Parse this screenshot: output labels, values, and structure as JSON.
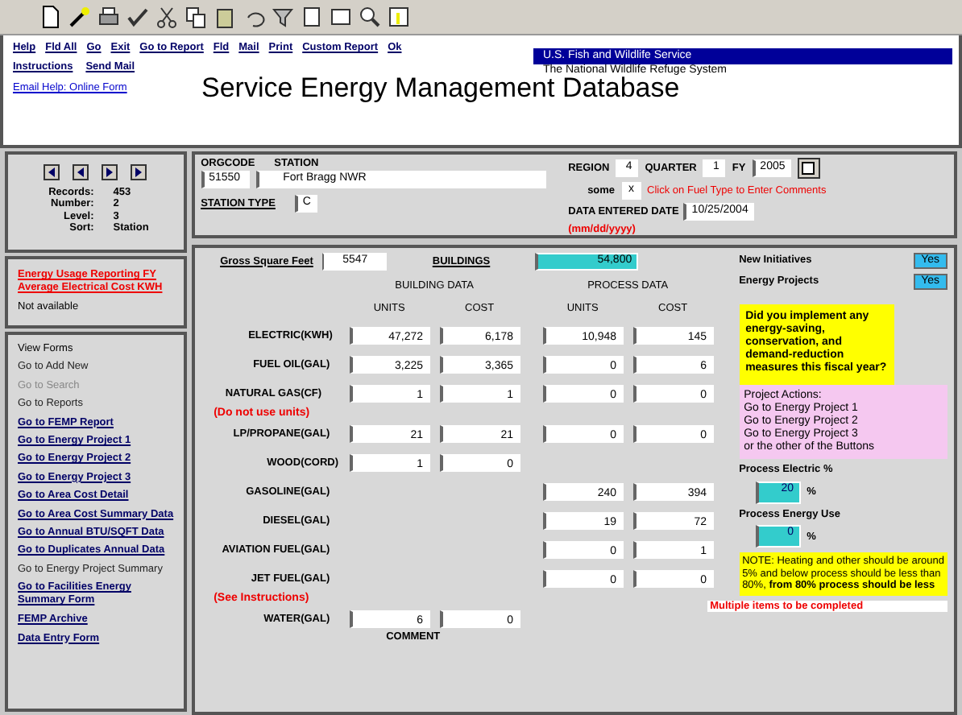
{
  "header": {
    "links_row1": [
      {
        "label": "Help"
      },
      {
        "label": "Fld All"
      },
      {
        "label": "Go"
      },
      {
        "label": "Exit"
      },
      {
        "label": "Go to Report"
      },
      {
        "label": "Fld"
      },
      {
        "label": "Mail"
      },
      {
        "label": "Print"
      },
      {
        "label": "Custom Report"
      },
      {
        "label": "Ok"
      }
    ],
    "links_row2": [
      {
        "label": "Instructions"
      },
      {
        "label": "Send Mail"
      }
    ],
    "help_link": "Email Help: Online Form",
    "title": "Service Energy Management Database",
    "agency": "U.S. Fish and Wildlife Service",
    "system": "The National Wildlife Refuge System"
  },
  "navigator": {
    "stats": [
      {
        "label": "Records:",
        "value": "453"
      },
      {
        "label": "Number:",
        "value": "2"
      },
      {
        "label": "Level:",
        "value": "3"
      },
      {
        "label": "Sort:",
        "value": "Station"
      }
    ]
  },
  "report_links": [
    {
      "label": "Energy Usage Reporting FY"
    },
    {
      "label": "Average Electrical Cost KWH"
    }
  ],
  "report_note": "Not available",
  "view_forms": {
    "heading": "View Forms",
    "items": [
      {
        "label": "Go to Add New",
        "kind": "text"
      },
      {
        "label": "Go to Search",
        "kind": "muted"
      },
      {
        "label": "Go to Reports",
        "kind": "text"
      },
      {
        "label": "Go to FEMP Report",
        "kind": "link"
      },
      {
        "label": "Go to Energy Project 1",
        "kind": "link"
      },
      {
        "label": "Go to Energy Project 2",
        "kind": "link"
      },
      {
        "label": "Go to Energy Project 3",
        "kind": "link"
      },
      {
        "label": "Go to Area Cost Detail",
        "kind": "link"
      },
      {
        "label": "Go to Area Cost Summary Data",
        "kind": "link"
      },
      {
        "label": "Go to Annual BTU/SQFT Data",
        "kind": "link"
      },
      {
        "label": "Go to Duplicates Annual Data",
        "kind": "link"
      },
      {
        "label": "Go to Energy Project Summary",
        "kind": "text"
      },
      {
        "label": "Go to Facilities Energy Summary Form",
        "kind": "link"
      },
      {
        "label": "FEMP Archive",
        "kind": "link"
      },
      {
        "label": "Data Entry Form",
        "kind": "link"
      }
    ]
  },
  "station": {
    "orgcode_label": "ORGCODE",
    "orgcode": "51550",
    "station_label": "STATION",
    "station": "Fort Bragg NWR",
    "type_label": "STATION TYPE",
    "type": "C",
    "region_label": "REGION",
    "region": "4",
    "quarter_label": "QUARTER",
    "quarter": "1",
    "fy_label": "FY",
    "fy": "2005",
    "some_label": "some",
    "some": "x",
    "comments_note": "Click on Fuel Type to Enter Comments",
    "date_label": "DATA ENTERED DATE",
    "date": "10/25/2004",
    "date_hint": "(mm/dd/yyyy)"
  },
  "form": {
    "gsf_label": "Gross Square Feet",
    "gsf": "5547",
    "buildings_label": "BUILDINGS",
    "buildings": "54,800",
    "initiatives": [
      {
        "label": "New Initiatives",
        "value": "Yes"
      },
      {
        "label": "Energy Projects",
        "value": "Yes"
      }
    ],
    "building_heading": "BUILDING DATA",
    "process_heading": "PROCESS DATA",
    "building_units_label": "UNITS",
    "building_cost_label": "COST",
    "process_units_label": "UNITS",
    "process_cost_label": "COST",
    "rows": [
      {
        "kind": "fuel",
        "name": "ELECTRIC",
        "unit": "(KWH)",
        "bu": "47,272",
        "bc": "6,178",
        "pu": "10,948",
        "pc": "145"
      },
      {
        "kind": "fuel",
        "name": "FUEL OIL",
        "unit": "(GAL)",
        "bu": "3,225",
        "bc": "3,365",
        "pu": "0",
        "pc": "6"
      },
      {
        "kind": "fuel",
        "name": "NATURAL GAS",
        "unit": "(CF)",
        "bu": "1",
        "bc": "1",
        "pu": "0",
        "pc": "0"
      },
      {
        "kind": "note",
        "text": "(Do not use units)"
      },
      {
        "kind": "fuel",
        "name": "LP/PROPANE",
        "unit": "(GAL)",
        "bu": "21",
        "bc": "21",
        "pu": "0",
        "pc": "0"
      },
      {
        "kind": "fuel",
        "name": "WOOD",
        "unit": "(CORD)",
        "bu": "1",
        "bc": "0"
      },
      {
        "kind": "fuel",
        "name": "GASOLINE",
        "unit": "(GAL)",
        "pu": "240",
        "pc": "394"
      },
      {
        "kind": "fuel",
        "name": "DIESEL",
        "unit": "(GAL)",
        "pu": "19",
        "pc": "72"
      },
      {
        "kind": "fuel",
        "name": "AVIATION FUEL",
        "unit": "(GAL)",
        "pu": "0",
        "pc": "1"
      },
      {
        "kind": "fuel",
        "name": "JET FUEL",
        "unit": "(GAL)",
        "pu": "0",
        "pc": "0"
      },
      {
        "kind": "note",
        "text": "(See Instructions)"
      },
      {
        "kind": "fuel",
        "name": "WATER",
        "unit": "(GAL)",
        "bu": "6",
        "bc": "0"
      }
    ],
    "comment_label": "COMMENT",
    "question": "Did you implement any energy-saving, conservation, and demand-reduction measures this fiscal year?",
    "project_actions": [
      "Project Actions:",
      "Go to Energy Project 1",
      "Go to Energy Project 2",
      "Go to Energy Project 3",
      "or the other of the Buttons"
    ],
    "process_electric_label": "Process Electric %",
    "process_electric": "20",
    "percent": "%",
    "process_energy_label": "Process Energy Use",
    "process_energy": "0",
    "percent2": "%",
    "note": "NOTE: Heating and other should be around 5% and below process should be less than 80%, **from 80% process should be less**",
    "warning": "Multiple items to be completed"
  }
}
